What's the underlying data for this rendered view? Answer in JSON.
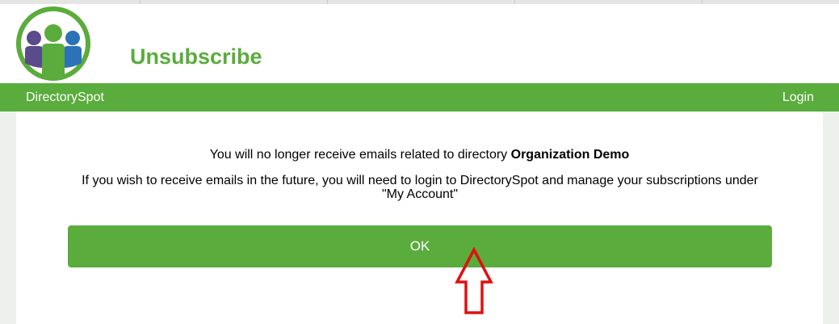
{
  "header": {
    "title": "Unsubscribe",
    "logo_icon": "people-group-logo-icon"
  },
  "navbar": {
    "brand": "DirectorySpot",
    "login": "Login"
  },
  "message": {
    "line1_prefix": "You will no longer receive emails related to directory ",
    "directory_name": "Organization Demo",
    "line2": "If you wish to receive emails in the future, you will need to login to DirectorySpot and manage your subscriptions under \"My Account\""
  },
  "ok_button": {
    "label": "OK"
  },
  "annotation": {
    "icon": "red-up-arrow-icon"
  },
  "colors": {
    "brand_green": "#5aac3c",
    "annotation_red": "#e01010",
    "logo_purple": "#5b4a8c",
    "logo_blue": "#2c72b8"
  }
}
